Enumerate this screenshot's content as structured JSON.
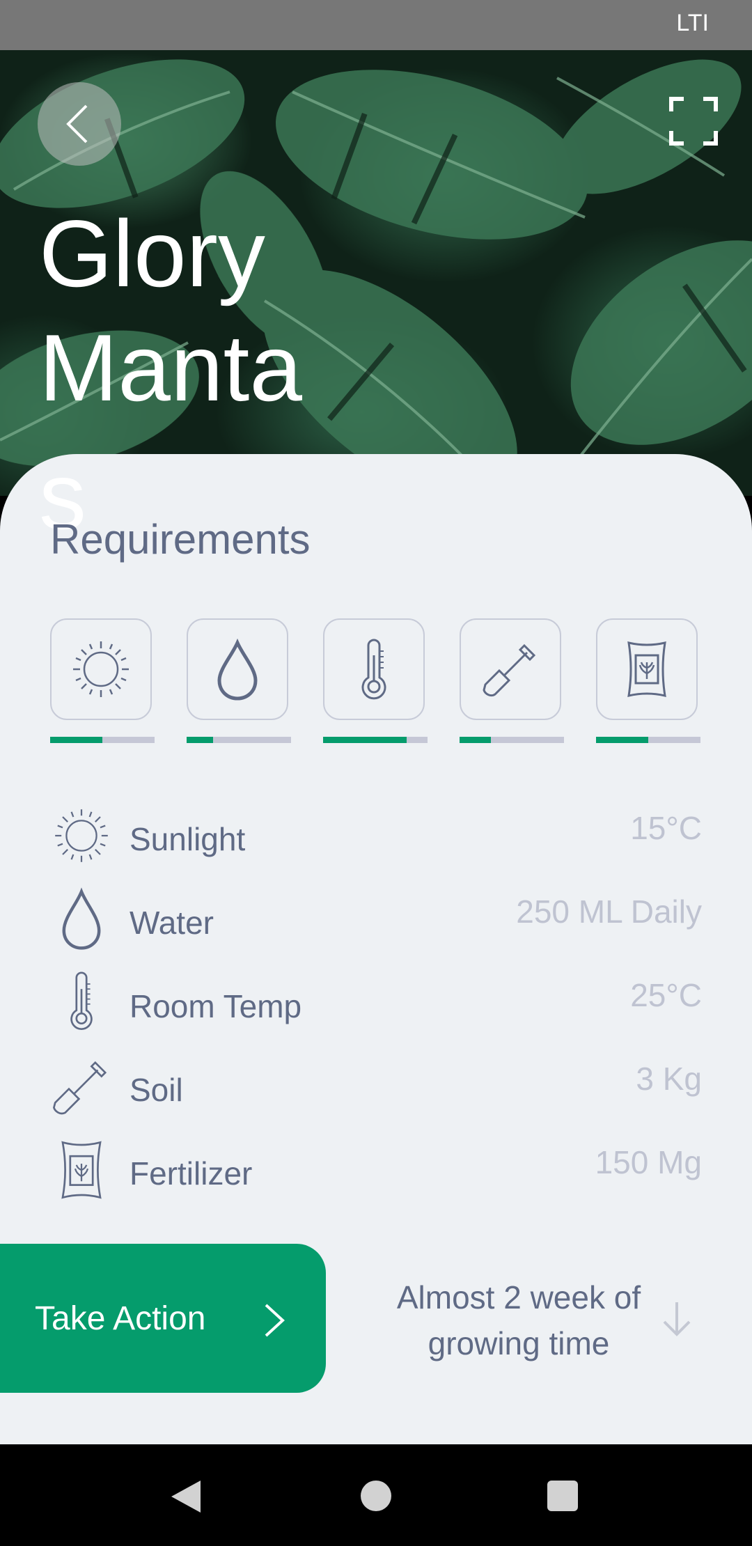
{
  "status_bar": {
    "text": "LTI"
  },
  "header": {
    "title": "Glory Manta",
    "title_overflow": "s"
  },
  "requirements": {
    "title": "Requirements",
    "items": [
      {
        "label": "Sunlight",
        "value": "15°C",
        "icon": "sun-icon",
        "level": 0.5
      },
      {
        "label": "Water",
        "value": "250 ML Daily",
        "icon": "water-drop-icon",
        "level": 0.25
      },
      {
        "label": "Room Temp",
        "value": "25°C",
        "icon": "thermometer-icon",
        "level": 0.8
      },
      {
        "label": "Soil",
        "value": "3 Kg",
        "icon": "shovel-icon",
        "level": 0.3
      },
      {
        "label": "Fertilizer",
        "value": "150 Mg",
        "icon": "fertilizer-bag-icon",
        "level": 0.5
      }
    ]
  },
  "action": {
    "label": "Take Action",
    "growing_time": "Almost 2 week of growing time"
  },
  "colors": {
    "accent": "#059c6c",
    "text": "#5f6a85",
    "muted": "#bfc3d1",
    "sheet": "#eef1f4"
  }
}
